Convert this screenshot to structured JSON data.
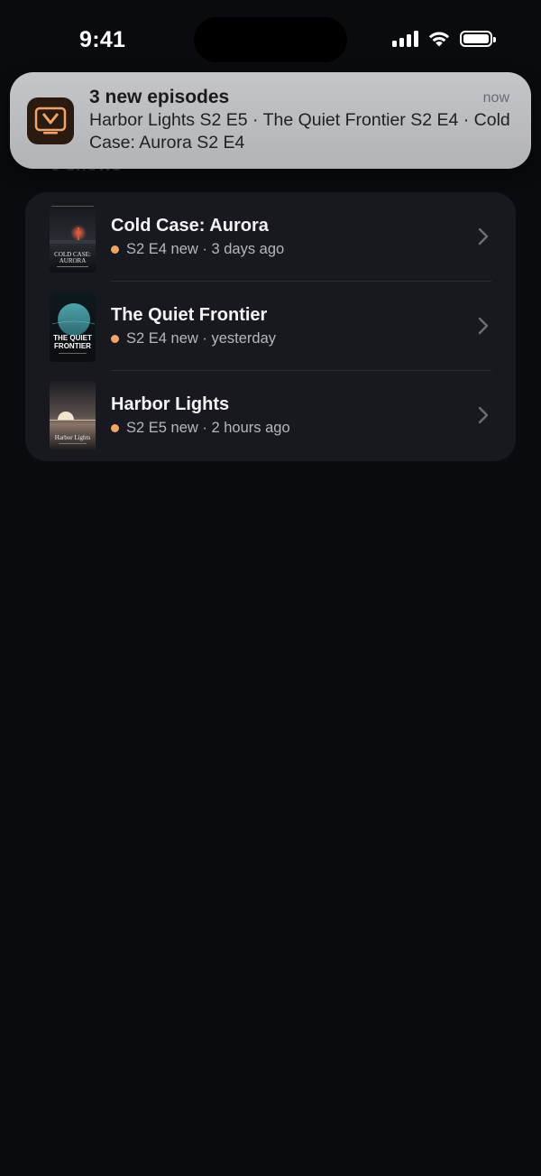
{
  "status_bar": {
    "time": "9:41"
  },
  "banner": {
    "title": "3 new episodes",
    "time": "now",
    "body": "Harbor Lights S2 E5 · The Quiet Frontier S2 E4 · Cold Case: Aurora S2 E4",
    "app_icon": "tv-play-icon"
  },
  "section": {
    "label": "3 shows"
  },
  "shows": [
    {
      "title": "Cold Case: Aurora",
      "badge": "S2 E4 new",
      "when": "3 days ago",
      "poster_text": "COLD CASE: AURORA"
    },
    {
      "title": "The Quiet Frontier",
      "badge": "S2 E4 new",
      "when": "yesterday",
      "poster_text": "THE QUIET FRONTIER"
    },
    {
      "title": "Harbor Lights",
      "badge": "S2 E5 new",
      "when": "2 hours ago",
      "poster_text": "Harbor Lights"
    }
  ],
  "colors": {
    "accent_dot": "#f0a46a",
    "card": "#18191e",
    "background": "#0a0b0f"
  }
}
